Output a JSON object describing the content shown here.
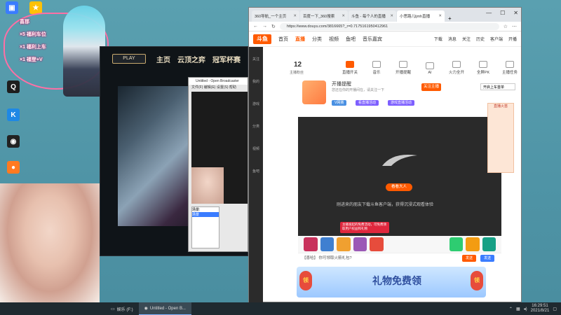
{
  "desktop": {
    "icons": [
      {
        "label": "",
        "color": "#3a7cff"
      },
      {
        "label": "",
        "color": "#ffc107"
      },
      {
        "label": "QQ",
        "color": "#1e1e1e"
      },
      {
        "label": "KS",
        "color": "#1e88e5"
      },
      {
        "label": "",
        "color": "#222"
      },
      {
        "label": "",
        "color": "#ff7a20"
      }
    ]
  },
  "overlay": {
    "lines": [
      "喜那",
      "×5 福利车位",
      "×1 福利上车",
      "×1 福登+V"
    ]
  },
  "game": {
    "play_label": "PLAY",
    "nav": [
      "主页",
      "云顶之弈",
      "冠军杯赛"
    ]
  },
  "obs": {
    "title": "Untitled - Open Broadcaster",
    "menu": "文件(F)  编辑(E)  设置(S)  帮助",
    "scene_label": "场景:",
    "scene_item": "场景"
  },
  "browser": {
    "tabs": [
      {
        "title": "360导航_一个主页",
        "active": false
      },
      {
        "title": "百度一下_360搜索",
        "active": false
      },
      {
        "title": "斗鱼 - 每个人的直播",
        "active": false
      },
      {
        "title": "小思路儿ljmh直播",
        "active": true
      }
    ],
    "address": "https://www.douyu.com/3816665?_r=0.7175161950412961",
    "window_controls": [
      "—",
      "☐",
      "✕"
    ]
  },
  "site": {
    "logo": "斗鱼",
    "nav": [
      "首页",
      "直播",
      "分类",
      "视频",
      "鱼吧",
      "音乐嘉宾"
    ],
    "active_nav": "直播",
    "header_right": [
      "下载",
      "消息",
      "关注",
      "历史",
      "客户端",
      "开播"
    ]
  },
  "sidenav": [
    "关注",
    "我的",
    "游戏",
    "分类",
    "视频",
    "鱼吧"
  ],
  "room": {
    "count": "12",
    "count_label": "主播粉丝",
    "toolbar": [
      "直播开关",
      "音乐",
      "开播提醒",
      "AI",
      "火力全开",
      "全屏PK",
      "主播任务",
      "上车"
    ],
    "streamer_title": "开播提醒",
    "streamer_sub": "您还在你的开播间在，请关注一下",
    "follow_label": "关注主播",
    "tags": [
      {
        "label": "V网赛",
        "color": "#4a90e2"
      },
      {
        "label": "看直播活动",
        "color": "#7d5fff"
      },
      {
        "label": "游戏直播活动",
        "color": "#7d5fff"
      }
    ],
    "live_btn": "看看大人",
    "player_msg": "刚进来的朋友下载斗鱼客户端，获得沉浸式观看体验",
    "promo": "主播发起的免费活动，可免费领取用户权益和礼物",
    "gifts": [
      "#c8325c",
      "#3f7fd0",
      "#f0a030",
      "#9b59b6",
      "#e74c3c",
      "#2ecc71",
      "#f39c12",
      "#16a085"
    ],
    "chat_placeholder": "【喜哈】 你可领取火箭礼包?",
    "send_label": "发送",
    "send2_label": "发送",
    "right_popup": "开启上车首单",
    "right_box": "直播火苗",
    "ad_text": "礼物免费领",
    "ad_coins": [
      "领",
      "领"
    ]
  },
  "taskbar": {
    "items": [
      {
        "label": "娱乐 (F:)",
        "active": false
      },
      {
        "label": "Untitled - Open B...",
        "active": true
      }
    ],
    "time": "16:29:51",
    "date": "2021/8/21"
  }
}
